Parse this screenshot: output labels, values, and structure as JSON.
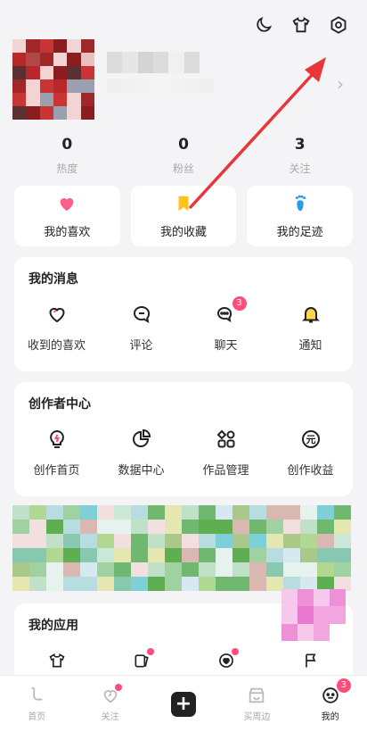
{
  "stats": [
    {
      "value": "0",
      "label": "热度"
    },
    {
      "value": "0",
      "label": "粉丝"
    },
    {
      "value": "3",
      "label": "关注"
    }
  ],
  "quick_links": [
    {
      "label": "我的喜欢",
      "icon": "heart-icon",
      "color": "#ff5f8a"
    },
    {
      "label": "我的收藏",
      "icon": "bookmark-icon",
      "color": "#ffc21a"
    },
    {
      "label": "我的足迹",
      "icon": "footprint-icon",
      "color": "#2b9ae8"
    }
  ],
  "messages": {
    "title": "我的消息",
    "items": [
      {
        "label": "收到的喜欢",
        "icon": "heart-outline-icon"
      },
      {
        "label": "评论",
        "icon": "comment-icon"
      },
      {
        "label": "聊天",
        "icon": "chat-icon",
        "badge": "3"
      },
      {
        "label": "通知",
        "icon": "bell-icon"
      }
    ]
  },
  "creator": {
    "title": "创作者中心",
    "items": [
      {
        "label": "创作首页",
        "icon": "bulb-icon"
      },
      {
        "label": "数据中心",
        "icon": "pie-chart-icon"
      },
      {
        "label": "作品管理",
        "icon": "apps-grid-icon"
      },
      {
        "label": "创作收益",
        "icon": "yuan-coin-icon",
        "symbol": "元"
      }
    ]
  },
  "apps": {
    "title": "我的应用",
    "items": [
      {
        "icon": "shirt-icon"
      },
      {
        "icon": "cards-icon",
        "dot": true
      },
      {
        "icon": "heart-circle-icon",
        "dot": true
      },
      {
        "icon": "flag-icon"
      }
    ]
  },
  "tabbar": [
    {
      "label": "首页",
      "icon": "home-icon"
    },
    {
      "label": "关注",
      "icon": "follow-icon",
      "dot": true
    },
    {
      "label": "",
      "icon": "plus-icon",
      "symbol": "+"
    },
    {
      "label": "买周边",
      "icon": "shop-icon"
    },
    {
      "label": "我的",
      "icon": "me-icon",
      "badge": "3",
      "active": true
    }
  ],
  "colors": {
    "accent": "#ff4d7a",
    "arrow": "#e8363a"
  }
}
